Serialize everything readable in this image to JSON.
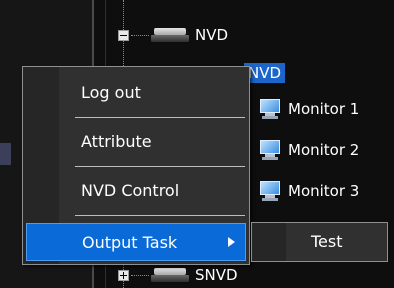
{
  "tree": {
    "items": [
      {
        "label": "NVD"
      },
      {
        "label": "NVD"
      },
      {
        "label": "Monitor 1"
      },
      {
        "label": "Monitor 2"
      },
      {
        "label": "Monitor 3"
      },
      {
        "label": "SNVD"
      }
    ]
  },
  "context_menu": {
    "items": [
      {
        "label": "Log out"
      },
      {
        "label": "Attribute"
      },
      {
        "label": "NVD Control"
      },
      {
        "label": "Output Task"
      }
    ]
  },
  "submenu": {
    "items": [
      {
        "label": "Test"
      }
    ]
  },
  "colors": {
    "selection": "#1c66c9",
    "menu_highlight": "#0a6ad8",
    "menu_bg": "#303030"
  },
  "icons": [
    "device-icon",
    "monitor-icon",
    "expand-icon",
    "collapse-icon",
    "submenu-arrow-icon"
  ]
}
